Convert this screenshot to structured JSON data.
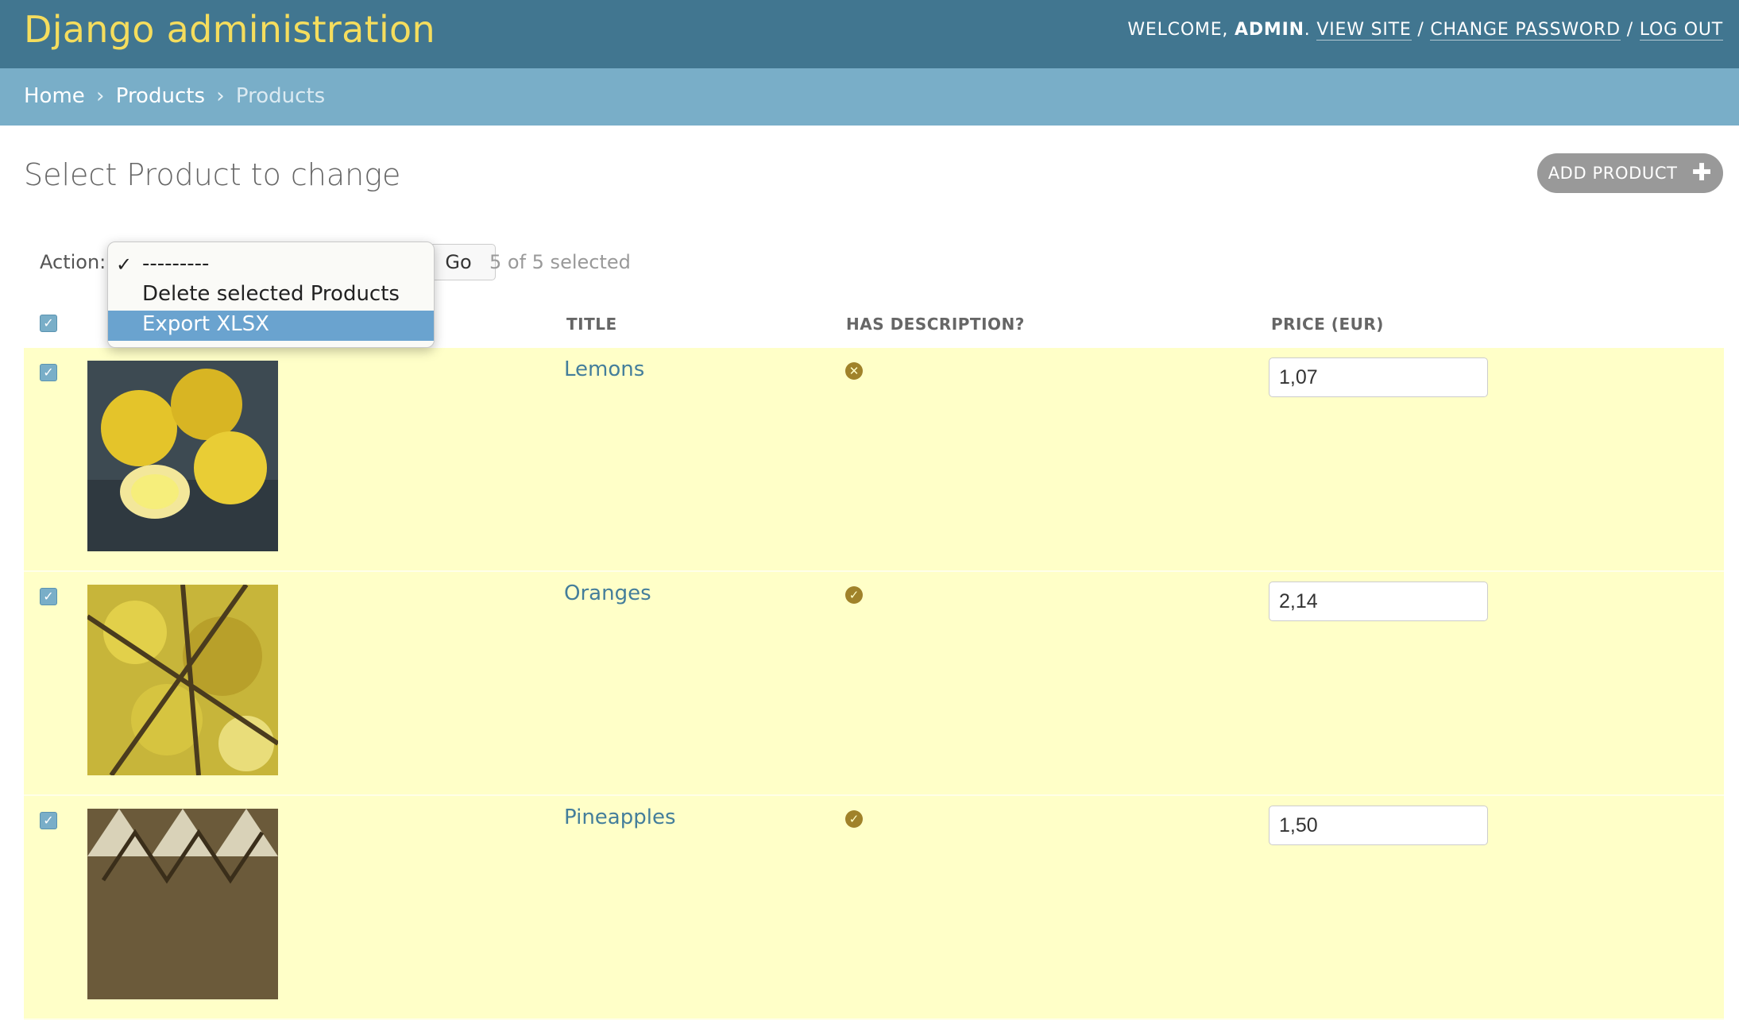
{
  "header": {
    "brand": "Django administration",
    "welcome": "WELCOME,",
    "username": "ADMIN",
    "view_site": "VIEW SITE",
    "change_password": "CHANGE PASSWORD",
    "log_out": "LOG OUT",
    "separator": "/"
  },
  "breadcrumbs": {
    "home": "Home",
    "app": "Products",
    "current": "Products",
    "separator": "›"
  },
  "page": {
    "title": "Select Product to change",
    "add_button": "ADD PRODUCT"
  },
  "actions": {
    "label": "Action:",
    "go": "Go",
    "selected_count": "5 of 5 selected",
    "options": [
      {
        "label": "---------",
        "checked": true
      },
      {
        "label": "Delete selected Products",
        "checked": false
      },
      {
        "label": "Export XLSX",
        "checked": false,
        "highlighted": true
      }
    ]
  },
  "table": {
    "columns": [
      "TITLE",
      "HAS DESCRIPTION?",
      "PRICE (EUR)"
    ],
    "rows": [
      {
        "title": "Lemons",
        "has_description": false,
        "price": "1,07",
        "selected": true
      },
      {
        "title": "Oranges",
        "has_description": true,
        "price": "2,14",
        "selected": true
      },
      {
        "title": "Pineapples",
        "has_description": true,
        "price": "1,50",
        "selected": true
      }
    ]
  },
  "colors": {
    "header_bg": "#417690",
    "brand": "#f5dd5d",
    "breadcrumb_bg": "#79aec8",
    "selected_row_bg": "#ffffc8",
    "link": "#447e9b"
  }
}
